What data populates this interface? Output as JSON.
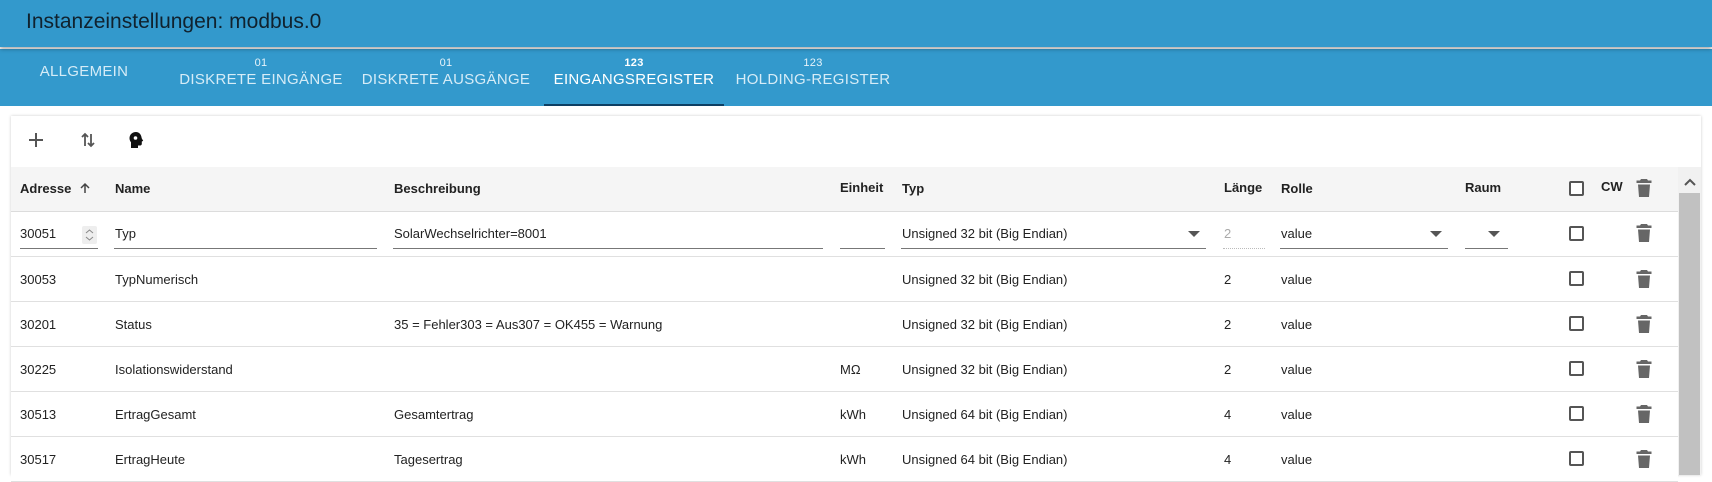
{
  "window": {
    "title": "Instanzeinstellungen: modbus.0"
  },
  "tabs": [
    {
      "badge": "",
      "label": "ALLGEMEIN"
    },
    {
      "badge": "01",
      "label": "DISKRETE EINGÄNGE"
    },
    {
      "badge": "01",
      "label": "DISKRETE AUSGÄNGE"
    },
    {
      "badge": "123",
      "label": "EINGANGSREGISTER"
    },
    {
      "badge": "123",
      "label": "HOLDING-REGISTER"
    }
  ],
  "active_tab": "EINGANGSREGISTER",
  "toolbar": {
    "add_icon": "plus-icon",
    "sort_icon": "swap-vertical-icon",
    "role_icon": "head-icon"
  },
  "table": {
    "columns": {
      "address": "Adresse",
      "name": "Name",
      "description": "Beschreibung",
      "unit": "Einheit",
      "type": "Typ",
      "length": "Länge",
      "role": "Rolle",
      "room": "Raum",
      "cw": "CW"
    },
    "edit_row": {
      "address": "30051",
      "name": "Typ",
      "description": "SolarWechselrichter=8001",
      "unit": "",
      "type": "Unsigned 32 bit (Big Endian)",
      "length": "2",
      "role": "value",
      "room": ""
    },
    "rows": [
      {
        "address": "30053",
        "name": "TypNumerisch",
        "description": "",
        "unit": "",
        "type": "Unsigned 32 bit (Big Endian)",
        "length": "2",
        "role": "value"
      },
      {
        "address": "30201",
        "name": "Status",
        "description": "35 = Fehler303 = Aus307 = OK455 = Warnung",
        "unit": "",
        "type": "Unsigned 32 bit (Big Endian)",
        "length": "2",
        "role": "value"
      },
      {
        "address": "30225",
        "name": "Isolationswiderstand",
        "description": "",
        "unit": "MΩ",
        "type": "Unsigned 32 bit (Big Endian)",
        "length": "2",
        "role": "value"
      },
      {
        "address": "30513",
        "name": "ErtragGesamt",
        "description": "Gesamtertrag",
        "unit": "kWh",
        "type": "Unsigned 64 bit (Big Endian)",
        "length": "4",
        "role": "value"
      },
      {
        "address": "30517",
        "name": "ErtragHeute",
        "description": "Tagesertrag",
        "unit": "kWh",
        "type": "Unsigned 64 bit (Big Endian)",
        "length": "4",
        "role": "value"
      }
    ]
  },
  "colors": {
    "accent": "#3399cc",
    "active_underline": "#0d3f63",
    "header_bg": "#f5f5f5"
  }
}
